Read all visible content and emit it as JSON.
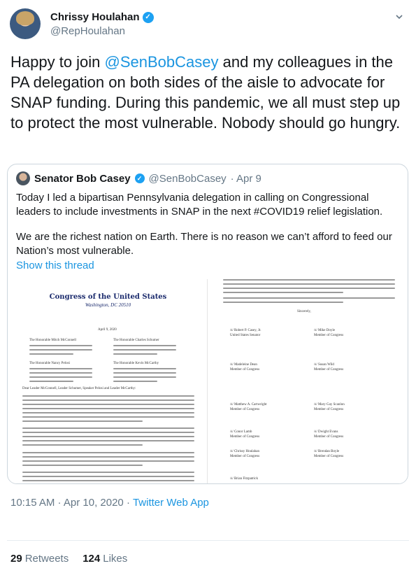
{
  "author": {
    "name": "Chrissy Houlahan",
    "handle": "@RepHoulahan"
  },
  "tweet": {
    "text_before": "Happy to join ",
    "mention": "@SenBobCasey",
    "text_after": " and my colleagues in the PA delegation on both sides of the aisle to advocate for SNAP funding. During this pandemic, we all must step up to protect the most vulnerable. Nobody should go hungry."
  },
  "quoted": {
    "name": "Senator Bob Casey",
    "handle": "@SenBobCasey",
    "date": "· Apr 9",
    "paragraph1": "Today I led a bipartisan Pennsylvania delegation in calling on Congressional leaders to include investments in SNAP in the next #COVID19 relief legislation.",
    "paragraph2": "We are the richest nation on Earth. There is no reason we can’t afford to feed our Nation’s most vulnerable.",
    "show_thread": "Show this thread",
    "letter": {
      "title": "Congress of the United States",
      "subtitle": "Washington, DC 20510",
      "date": "April 9, 2020",
      "addressees": [
        "The Honorable Mitch McConnell",
        "The Honorable Charles Schumer",
        "The Honorable Nancy Pelosi",
        "The Honorable Kevin McCarthy"
      ],
      "salutation": "Dear Leader McConnell, Leader Schumer, Speaker Pelosi and Leader McCarthy:",
      "closing": "Sincerely,",
      "signatories": [
        "/s/ Robert P. Casey, Jr.",
        "/s/ Mike Doyle",
        "/s/ Madeleine Dean",
        "/s/ Susan Wild",
        "/s/ Matthew A. Cartwright",
        "/s/ Mary Gay Scanlon",
        "/s/ Conor Lamb",
        "/s/ Dwight Evans",
        "/s/ Chrissy Houlahan",
        "/s/ Brendan Boyle",
        "/s/ Brian Fitzpatrick"
      ],
      "signatory_titles": [
        "United States Senator",
        "Member of Congress"
      ]
    }
  },
  "meta": {
    "time": "10:15 AM · Apr 10, 2020 · ",
    "source": "Twitter Web App"
  },
  "stats": {
    "retweets_count": "29",
    "retweets_label": "Retweets",
    "likes_count": "124",
    "likes_label": "Likes"
  },
  "colors": {
    "accent": "#1b95e0",
    "verified": "#1da1f2",
    "muted": "#657786"
  }
}
